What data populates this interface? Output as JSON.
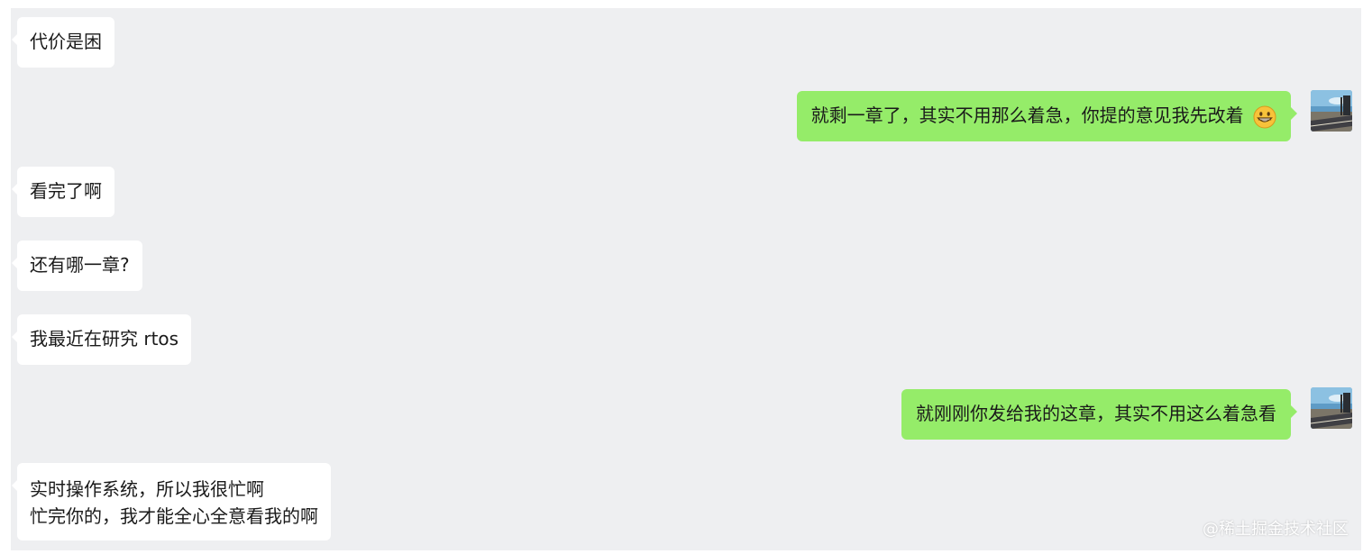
{
  "messages": [
    {
      "side": "in",
      "text": "代价是困"
    },
    {
      "side": "out",
      "text": "就剩一章了，其实不用那么着急，你提的意见我先改着",
      "emoji": "grinning-face-emoji"
    },
    {
      "side": "in",
      "text": "看完了啊"
    },
    {
      "side": "in",
      "text": "还有哪一章?"
    },
    {
      "side": "in",
      "text": "我最近在研究 rtos"
    },
    {
      "side": "out",
      "text": "就刚刚你发给我的这章，其实不用这么着急看"
    },
    {
      "side": "in",
      "lines": [
        "实时操作系统，所以我很忙啊",
        "忙完你的，我才能全心全意看我的啊"
      ]
    }
  ],
  "watermark": "@稀土掘金技术社区",
  "colors": {
    "background": "#eeeff1",
    "incoming_bubble": "#ffffff",
    "outgoing_bubble": "#95ec69"
  }
}
